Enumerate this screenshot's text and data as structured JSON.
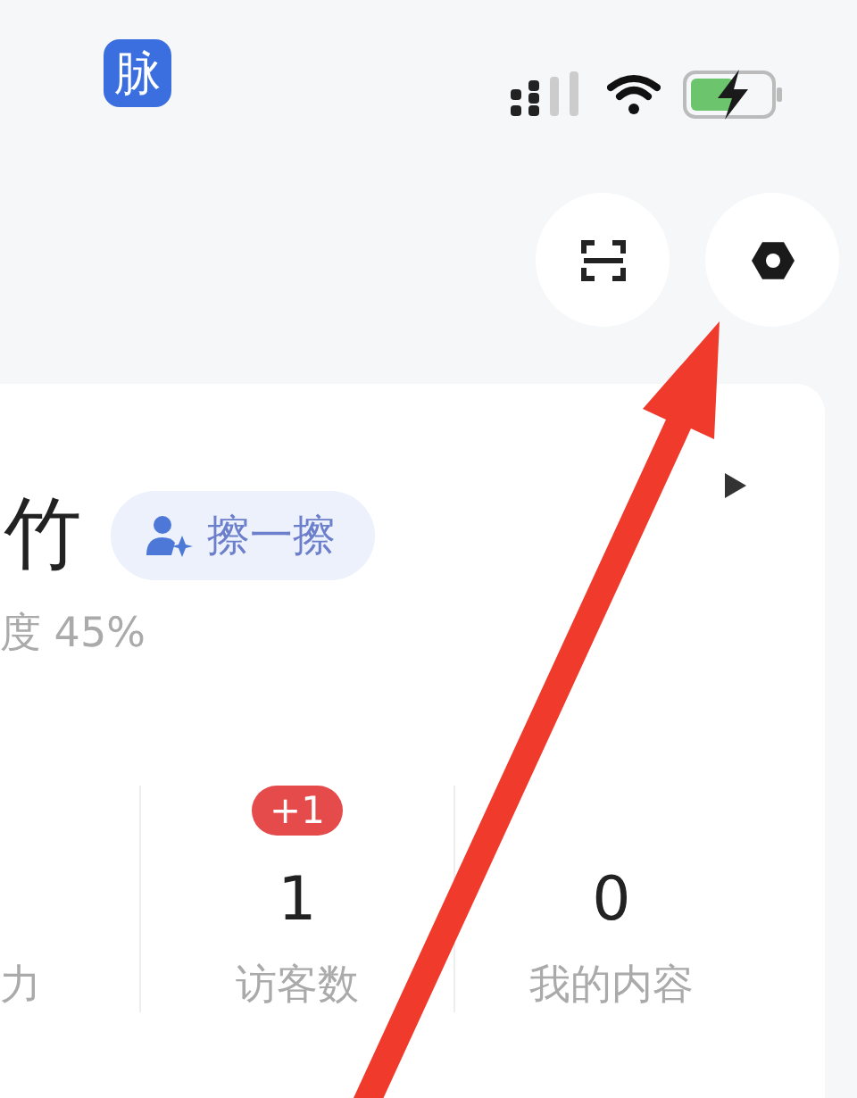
{
  "status_bar": {
    "app_icon_label": "脉"
  },
  "header": {
    "buttons": [
      {
        "kind": "scan"
      },
      {
        "kind": "settings"
      }
    ]
  },
  "profile": {
    "name": "竹",
    "action_button": "擦一擦",
    "completion": "度 45%"
  },
  "stats": [
    {
      "label": "力"
    },
    {
      "value": "1",
      "label": "访客数",
      "badge": "+1"
    },
    {
      "value": "0",
      "label": "我的内容"
    }
  ]
}
